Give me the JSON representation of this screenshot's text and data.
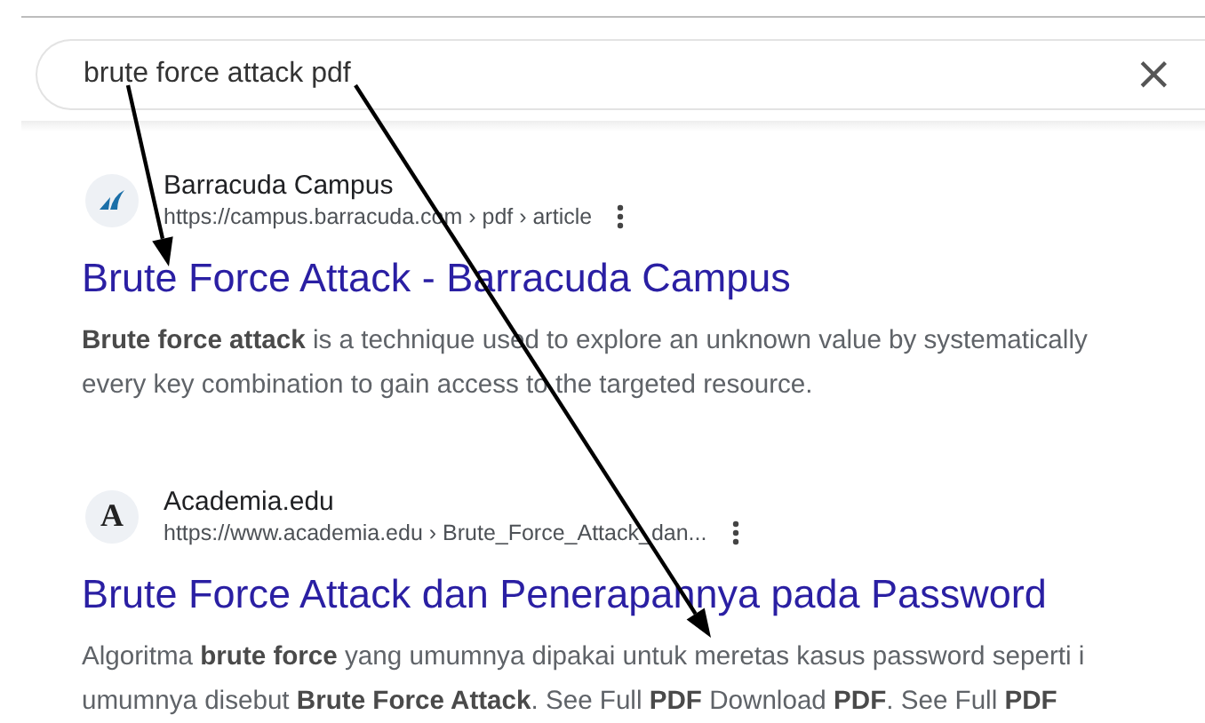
{
  "search": {
    "value": "brute force attack pdf",
    "clear_label": "×"
  },
  "results": [
    {
      "site": "Barracuda Campus",
      "url": "https://campus.barracuda.com › pdf › article",
      "kind": "fin",
      "title": "Brute Force Attack - Barracuda Campus",
      "snippet": [
        "**Brute force attack** is a technique used to explore an unknown value by systematically",
        "every key combination to gain access to the targeted resource."
      ]
    },
    {
      "site": "Academia.edu",
      "url": "https://www.academia.edu › Brute_Force_Attack_dan...",
      "kind": "letter",
      "icon_text": "A",
      "title": "Brute Force Attack dan Penerapannya pada Password",
      "snippet": [
        "Algoritma **brute force** yang umumnya dipakai untuk meretas kasus password seperti i",
        "umumnya disebut **Brute Force Attack**. See Full **PDF** Download **PDF**. See Full **PDF**"
      ]
    }
  ],
  "annotations": [
    {
      "kind": "arrow"
    },
    {
      "kind": "arrow"
    }
  ]
}
